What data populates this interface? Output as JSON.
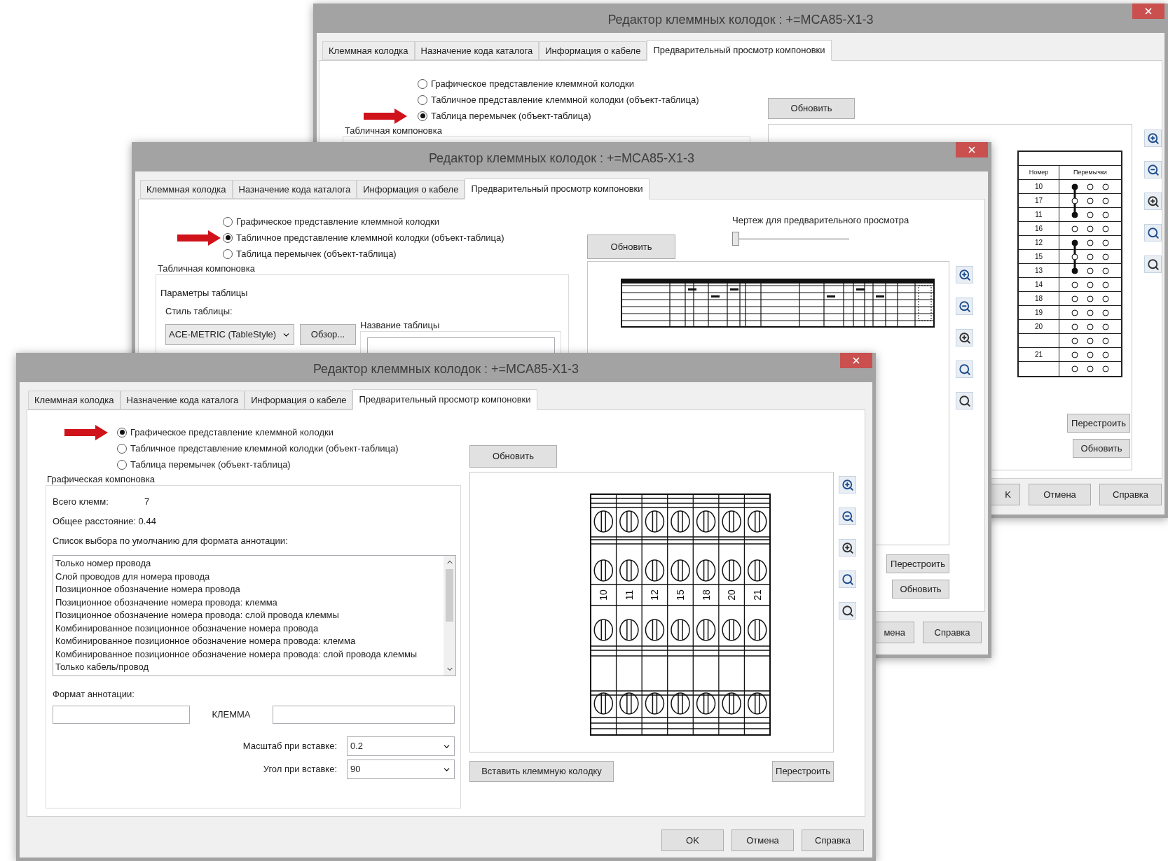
{
  "back_window": {
    "title": "Редактор клеммных колодок : +=MCA85-X1-3",
    "tabs": [
      {
        "label": "Клеммная колодка",
        "selected": false
      },
      {
        "label": "Назначение кода каталога",
        "selected": false
      },
      {
        "label": "Информация о кабеле",
        "selected": false
      },
      {
        "label": "Предварительный просмотр компоновки",
        "selected": true
      }
    ],
    "options": [
      {
        "label": "Графическое представление клеммной колодки",
        "selected": false
      },
      {
        "label": "Табличное представление клеммной колодки (объект-таблица)",
        "selected": false
      },
      {
        "label": "Таблица перемычек (объект-таблица)",
        "selected": true
      }
    ],
    "layout_group": "Табличная компоновка",
    "refresh_button": "Обновить",
    "jumper_table": {
      "columns": [
        "Номер",
        "Перемычки"
      ],
      "rows": [
        {
          "number": "10",
          "filled": true,
          "linked_above": false,
          "linked_below": true
        },
        {
          "number": "17",
          "filled": false,
          "linked_above": true,
          "linked_below": true
        },
        {
          "number": "11",
          "filled": true,
          "linked_above": true,
          "linked_below": false
        },
        {
          "number": "16",
          "filled": false,
          "linked_above": false,
          "linked_below": false
        },
        {
          "number": "12",
          "filled": true,
          "linked_above": false,
          "linked_below": true
        },
        {
          "number": "15",
          "filled": false,
          "linked_above": true,
          "linked_below": true
        },
        {
          "number": "13",
          "filled": true,
          "linked_above": true,
          "linked_below": false
        },
        {
          "number": "14",
          "filled": false,
          "linked_above": false,
          "linked_below": false
        },
        {
          "number": "18",
          "filled": false,
          "linked_above": false,
          "linked_below": false
        },
        {
          "number": "19",
          "filled": false,
          "linked_above": false,
          "linked_below": false
        },
        {
          "number": "20",
          "filled": false,
          "linked_above": false,
          "linked_below": false
        },
        {
          "filled": false,
          "linked_above": false,
          "linked_below": false
        },
        {
          "number": "21",
          "filled": false,
          "linked_above": false,
          "linked_below": false
        },
        {
          "filled": false,
          "linked_above": false,
          "linked_below": false
        }
      ]
    },
    "rebuild_button": "Перестроить",
    "update_button": "Обновить",
    "dialog_buttons": [
      "K",
      "Отмена",
      "Справка"
    ]
  },
  "middle_window": {
    "title": "Редактор клеммных колодок : +=MCA85-X1-3",
    "tabs": [
      {
        "label": "Клеммная колодка",
        "selected": false
      },
      {
        "label": "Назначение кода каталога",
        "selected": false
      },
      {
        "label": "Информация о кабеле",
        "selected": false
      },
      {
        "label": "Предварительный просмотр компоновки",
        "selected": true
      }
    ],
    "options": [
      {
        "label": "Графическое представление клеммной колодки",
        "selected": false
      },
      {
        "label": "Табличное представление клеммной колодки (объект-таблица)",
        "selected": true
      },
      {
        "label": "Таблица перемычек (объект-таблица)",
        "selected": false
      }
    ],
    "layout_group": "Табличная компоновка",
    "params_group": "Параметры таблицы",
    "style_label": "Стиль таблицы:",
    "style_value": "ACE-METRIC (TableStyle)",
    "browse_button": "Обзор...",
    "name_group": "Название таблицы",
    "preview_label": "Чертеж для предварительного просмотра",
    "preview_slider": {
      "level": 0
    },
    "refresh_button": "Обновить",
    "rebuild_button": "Перестроить",
    "update_button": "Обновить",
    "dialog_buttons": [
      "мена",
      "Справка"
    ]
  },
  "front_window": {
    "title": "Редактор клеммных колодок : +=MCA85-X1-3",
    "tabs": [
      {
        "label": "Клеммная колодка",
        "selected": false
      },
      {
        "label": "Назначение кода каталога",
        "selected": false
      },
      {
        "label": "Информация о кабеле",
        "selected": false
      },
      {
        "label": "Предварительный просмотр компоновки",
        "selected": true
      }
    ],
    "options": [
      {
        "label": "Графическое представление клеммной колодки",
        "selected": true
      },
      {
        "label": "Табличное представление клеммной колодки (объект-таблица)",
        "selected": false
      },
      {
        "label": "Таблица перемычек (объект-таблица)",
        "selected": false
      }
    ],
    "layout_group": "Графическая компоновка",
    "total_label": "Всего клемм:",
    "total_value": "7",
    "distance": "Общее расстояние: 0.44",
    "list_label": "Список выбора по умолчанию для формата аннотации:",
    "annotation_list": [
      "Только номер провода",
      "Слой проводов для номера провода",
      "Позиционное обозначение номера провода",
      "Позиционное обозначение номера провода: клемма",
      "Позиционное обозначение номера провода: слой провода клеммы",
      "Комбинированное позиционное обозначение номера провода",
      "Комбинированное позиционное обозначение номера провода: клемма",
      "Комбинированное позиционное обозначение номера провода: слой провода клеммы",
      "Только кабель/провод"
    ],
    "format_label": "Формат аннотации:",
    "format_middle": "КЛЕММА",
    "scale": {
      "label": "Масштаб при вставке:",
      "value": "0.2"
    },
    "angle": {
      "label": "Угол при вставке:",
      "value": "90"
    },
    "refresh_button": "Обновить",
    "terminal_labels": [
      "10",
      "11",
      "12",
      "15",
      "18",
      "20",
      "21"
    ],
    "insert_button": "Вставить клеммную колодку",
    "rebuild_button": "Перестроить",
    "dialog_buttons": [
      "OK",
      "Отмена",
      "Справка"
    ]
  }
}
